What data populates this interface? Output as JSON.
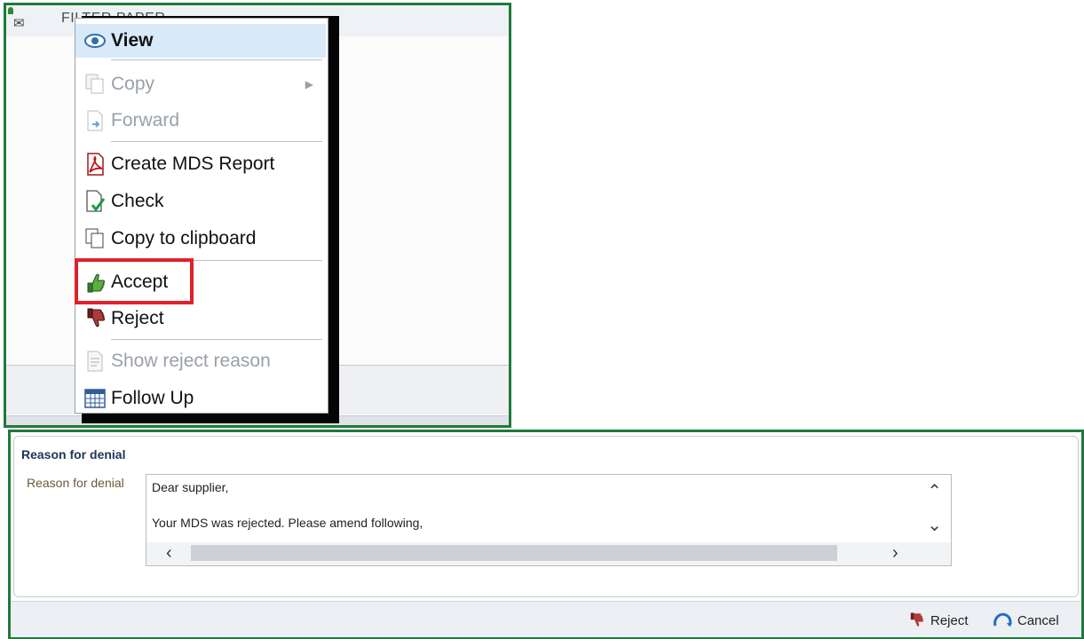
{
  "grid": {
    "column_header": "FILTER PAPER"
  },
  "context_menu": {
    "items": [
      {
        "label": "View",
        "icon": "eye-icon",
        "state": "highlighted"
      },
      {
        "label": "Copy",
        "icon": "copy-icon",
        "state": "disabled",
        "has_submenu": true
      },
      {
        "label": "Forward",
        "icon": "forward-document-icon",
        "state": "disabled"
      },
      {
        "label": "Create MDS Report",
        "icon": "pdf-icon",
        "state": "enabled"
      },
      {
        "label": "Check",
        "icon": "check-document-icon",
        "state": "enabled"
      },
      {
        "label": "Copy to clipboard",
        "icon": "clipboard-icon",
        "state": "enabled"
      },
      {
        "label": "Accept",
        "icon": "thumbs-up-icon",
        "state": "enabled",
        "emphasized": true
      },
      {
        "label": "Reject",
        "icon": "thumbs-down-icon",
        "state": "enabled"
      },
      {
        "label": "Show reject reason",
        "icon": "document-icon",
        "state": "disabled"
      },
      {
        "label": "Follow Up",
        "icon": "calendar-icon",
        "state": "enabled"
      }
    ]
  },
  "dialog": {
    "title": "Reason for denial",
    "field_label": "Reason for denial",
    "text_lines": [
      "Dear supplier,",
      "Your MDS was rejected. Please amend following,"
    ],
    "buttons": {
      "reject": "Reject",
      "cancel": "Cancel"
    }
  },
  "colors": {
    "frame_green": "#1f7a3a",
    "highlight_red": "#e0202a",
    "menu_highlight": "#d8e9f8"
  }
}
